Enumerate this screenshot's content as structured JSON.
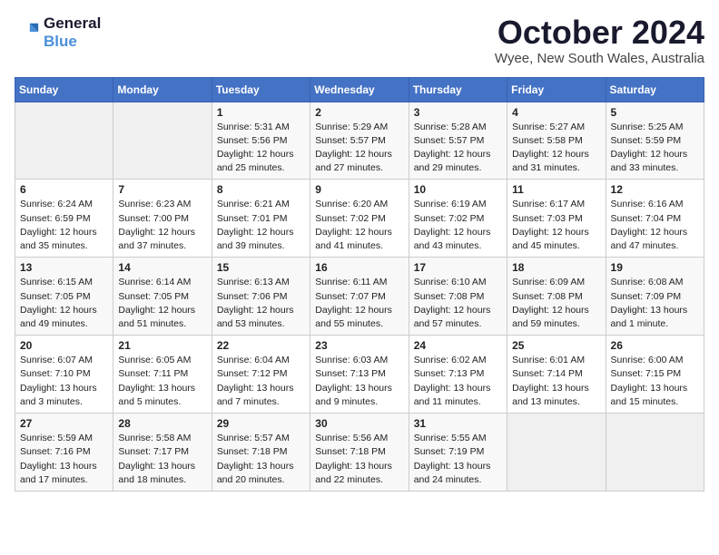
{
  "header": {
    "logo_line1": "General",
    "logo_line2": "Blue",
    "month": "October 2024",
    "location": "Wyee, New South Wales, Australia"
  },
  "weekdays": [
    "Sunday",
    "Monday",
    "Tuesday",
    "Wednesday",
    "Thursday",
    "Friday",
    "Saturday"
  ],
  "weeks": [
    [
      {
        "day": "",
        "empty": true
      },
      {
        "day": "",
        "empty": true
      },
      {
        "day": "1",
        "sunrise": "5:31 AM",
        "sunset": "5:56 PM",
        "daylight": "12 hours and 25 minutes."
      },
      {
        "day": "2",
        "sunrise": "5:29 AM",
        "sunset": "5:57 PM",
        "daylight": "12 hours and 27 minutes."
      },
      {
        "day": "3",
        "sunrise": "5:28 AM",
        "sunset": "5:57 PM",
        "daylight": "12 hours and 29 minutes."
      },
      {
        "day": "4",
        "sunrise": "5:27 AM",
        "sunset": "5:58 PM",
        "daylight": "12 hours and 31 minutes."
      },
      {
        "day": "5",
        "sunrise": "5:25 AM",
        "sunset": "5:59 PM",
        "daylight": "12 hours and 33 minutes."
      }
    ],
    [
      {
        "day": "6",
        "sunrise": "6:24 AM",
        "sunset": "6:59 PM",
        "daylight": "12 hours and 35 minutes."
      },
      {
        "day": "7",
        "sunrise": "6:23 AM",
        "sunset": "7:00 PM",
        "daylight": "12 hours and 37 minutes."
      },
      {
        "day": "8",
        "sunrise": "6:21 AM",
        "sunset": "7:01 PM",
        "daylight": "12 hours and 39 minutes."
      },
      {
        "day": "9",
        "sunrise": "6:20 AM",
        "sunset": "7:02 PM",
        "daylight": "12 hours and 41 minutes."
      },
      {
        "day": "10",
        "sunrise": "6:19 AM",
        "sunset": "7:02 PM",
        "daylight": "12 hours and 43 minutes."
      },
      {
        "day": "11",
        "sunrise": "6:17 AM",
        "sunset": "7:03 PM",
        "daylight": "12 hours and 45 minutes."
      },
      {
        "day": "12",
        "sunrise": "6:16 AM",
        "sunset": "7:04 PM",
        "daylight": "12 hours and 47 minutes."
      }
    ],
    [
      {
        "day": "13",
        "sunrise": "6:15 AM",
        "sunset": "7:05 PM",
        "daylight": "12 hours and 49 minutes."
      },
      {
        "day": "14",
        "sunrise": "6:14 AM",
        "sunset": "7:05 PM",
        "daylight": "12 hours and 51 minutes."
      },
      {
        "day": "15",
        "sunrise": "6:13 AM",
        "sunset": "7:06 PM",
        "daylight": "12 hours and 53 minutes."
      },
      {
        "day": "16",
        "sunrise": "6:11 AM",
        "sunset": "7:07 PM",
        "daylight": "12 hours and 55 minutes."
      },
      {
        "day": "17",
        "sunrise": "6:10 AM",
        "sunset": "7:08 PM",
        "daylight": "12 hours and 57 minutes."
      },
      {
        "day": "18",
        "sunrise": "6:09 AM",
        "sunset": "7:08 PM",
        "daylight": "12 hours and 59 minutes."
      },
      {
        "day": "19",
        "sunrise": "6:08 AM",
        "sunset": "7:09 PM",
        "daylight": "13 hours and 1 minute."
      }
    ],
    [
      {
        "day": "20",
        "sunrise": "6:07 AM",
        "sunset": "7:10 PM",
        "daylight": "13 hours and 3 minutes."
      },
      {
        "day": "21",
        "sunrise": "6:05 AM",
        "sunset": "7:11 PM",
        "daylight": "13 hours and 5 minutes."
      },
      {
        "day": "22",
        "sunrise": "6:04 AM",
        "sunset": "7:12 PM",
        "daylight": "13 hours and 7 minutes."
      },
      {
        "day": "23",
        "sunrise": "6:03 AM",
        "sunset": "7:13 PM",
        "daylight": "13 hours and 9 minutes."
      },
      {
        "day": "24",
        "sunrise": "6:02 AM",
        "sunset": "7:13 PM",
        "daylight": "13 hours and 11 minutes."
      },
      {
        "day": "25",
        "sunrise": "6:01 AM",
        "sunset": "7:14 PM",
        "daylight": "13 hours and 13 minutes."
      },
      {
        "day": "26",
        "sunrise": "6:00 AM",
        "sunset": "7:15 PM",
        "daylight": "13 hours and 15 minutes."
      }
    ],
    [
      {
        "day": "27",
        "sunrise": "5:59 AM",
        "sunset": "7:16 PM",
        "daylight": "13 hours and 17 minutes."
      },
      {
        "day": "28",
        "sunrise": "5:58 AM",
        "sunset": "7:17 PM",
        "daylight": "13 hours and 18 minutes."
      },
      {
        "day": "29",
        "sunrise": "5:57 AM",
        "sunset": "7:18 PM",
        "daylight": "13 hours and 20 minutes."
      },
      {
        "day": "30",
        "sunrise": "5:56 AM",
        "sunset": "7:18 PM",
        "daylight": "13 hours and 22 minutes."
      },
      {
        "day": "31",
        "sunrise": "5:55 AM",
        "sunset": "7:19 PM",
        "daylight": "13 hours and 24 minutes."
      },
      {
        "day": "",
        "empty": true
      },
      {
        "day": "",
        "empty": true
      }
    ]
  ]
}
